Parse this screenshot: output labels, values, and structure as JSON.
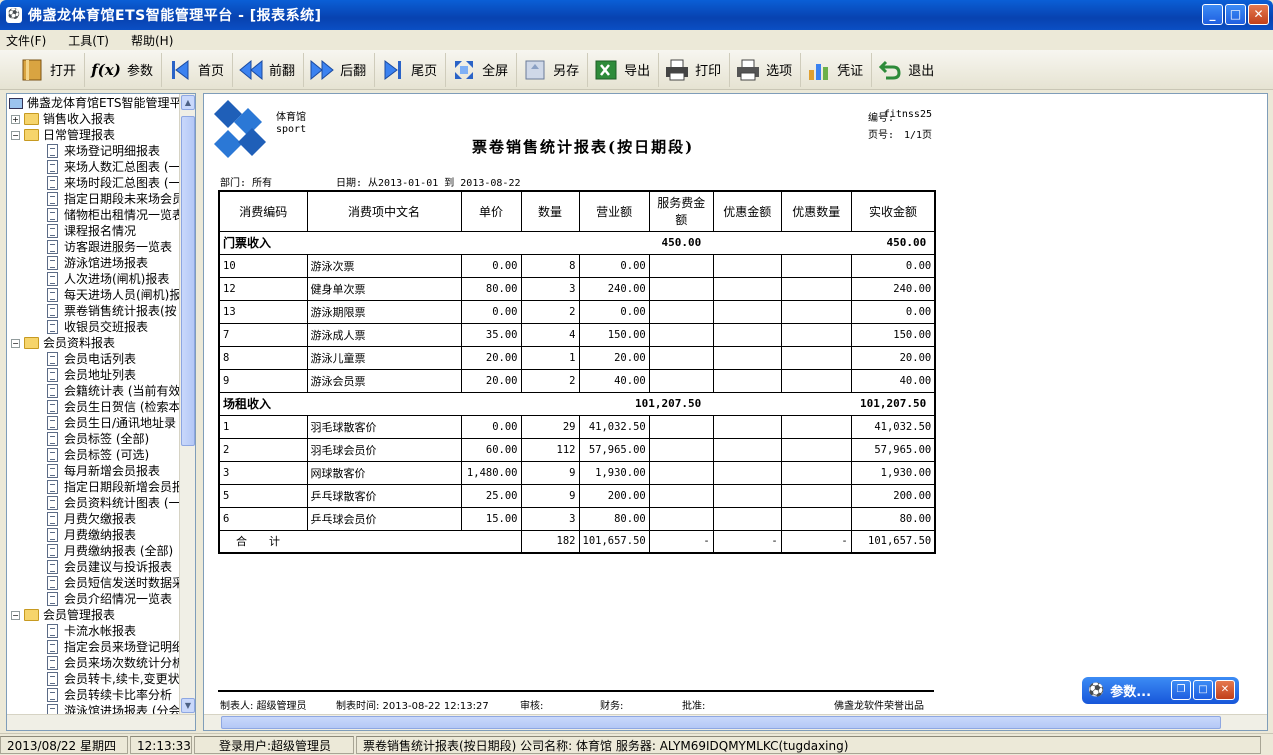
{
  "window": {
    "title": "佛盏龙体育馆ETS智能管理平台 - [报表系统]"
  },
  "menu": [
    "文件(F)",
    "工具(T)",
    "帮助(H)"
  ],
  "toolbar": {
    "open": "打开",
    "params": "参数",
    "first": "首页",
    "prev": "前翻",
    "next": "后翻",
    "last": "尾页",
    "fullscreen": "全屏",
    "saveas": "另存",
    "export": "导出",
    "print": "打印",
    "options": "选项",
    "voucher": "凭证",
    "exit": "退出",
    "fx_glyph": "f(x)"
  },
  "tree": {
    "root": "佛盏龙体育馆ETS智能管理平台",
    "items": [
      {
        "label": "销售收入报表",
        "level": 1,
        "folder": true,
        "expanded": false
      },
      {
        "label": "日常管理报表",
        "level": 1,
        "folder": true,
        "expanded": true
      },
      {
        "label": "来场登记明细报表",
        "level": 2
      },
      {
        "label": "来场人数汇总图表 (一",
        "level": 2
      },
      {
        "label": "来场时段汇总图表 (一",
        "level": 2
      },
      {
        "label": "指定日期段未来场会员",
        "level": 2
      },
      {
        "label": "储物柜出租情况一览表",
        "level": 2
      },
      {
        "label": "课程报名情况",
        "level": 2
      },
      {
        "label": "访客跟进服务一览表",
        "level": 2
      },
      {
        "label": "游泳馆进场报表",
        "level": 2
      },
      {
        "label": "人次进场(闸机)报表",
        "level": 2
      },
      {
        "label": "每天进场人员(闸机)报",
        "level": 2
      },
      {
        "label": "票卷销售统计报表(按",
        "level": 2,
        "selected": true
      },
      {
        "label": "收银员交班报表",
        "level": 2
      },
      {
        "label": "会员资料报表",
        "level": 1,
        "folder": true,
        "expanded": true
      },
      {
        "label": "会员电话列表",
        "level": 2
      },
      {
        "label": "会员地址列表",
        "level": 2
      },
      {
        "label": "会籍统计表 (当前有效",
        "level": 2
      },
      {
        "label": "会员生日贺信 (检索本",
        "level": 2
      },
      {
        "label": "会员生日/通讯地址录",
        "level": 2
      },
      {
        "label": "会员标签 (全部)",
        "level": 2
      },
      {
        "label": "会员标签 (可选)",
        "level": 2
      },
      {
        "label": "每月新增会员报表",
        "level": 2
      },
      {
        "label": "指定日期段新增会员报",
        "level": 2
      },
      {
        "label": "会员资料统计图表 (一",
        "level": 2
      },
      {
        "label": "月费欠缴报表",
        "level": 2
      },
      {
        "label": "月费缴纳报表",
        "level": 2
      },
      {
        "label": "月费缴纳报表 (全部)",
        "level": 2
      },
      {
        "label": "会员建议与投诉报表",
        "level": 2
      },
      {
        "label": "会员短信发送时数据采",
        "level": 2
      },
      {
        "label": "会员介绍情况一览表",
        "level": 2
      },
      {
        "label": "会员管理报表",
        "level": 1,
        "folder": true,
        "expanded": true
      },
      {
        "label": "卡流水帐报表",
        "level": 2
      },
      {
        "label": "指定会员来场登记明细",
        "level": 2
      },
      {
        "label": "会员来场次数统计分析",
        "level": 2
      },
      {
        "label": "会员转卡,续卡,变更状",
        "level": 2
      },
      {
        "label": "会员转续卡比率分析",
        "level": 2
      },
      {
        "label": "游泳馆进场报表 (分会",
        "level": 2
      }
    ]
  },
  "report": {
    "logo_text1": "体育馆",
    "logo_text2": "sport",
    "code_label": "编号:",
    "code_value": "fitnss25",
    "page_label": "页号:",
    "page_value": "1/1页",
    "title": "票卷销售统计报表(按日期段)",
    "dept": "部门: 所有",
    "date_range": "日期: 从2013-01-01 到 2013-08-22",
    "headers": [
      "消费编码",
      "消费项中文名",
      "单价",
      "数量",
      "营业额",
      "服务费金额",
      "优惠金额",
      "优惠数量",
      "实收金额"
    ],
    "groups": [
      {
        "name": "门票收入",
        "revenue": "450.00",
        "actual": "450.00",
        "rows": [
          {
            "code": "10",
            "name": "游泳次票",
            "price": "0.00",
            "qty": "8",
            "revenue": "0.00",
            "actual": "0.00"
          },
          {
            "code": "12",
            "name": "健身单次票",
            "price": "80.00",
            "qty": "3",
            "revenue": "240.00",
            "actual": "240.00"
          },
          {
            "code": "13",
            "name": "游泳期限票",
            "price": "0.00",
            "qty": "2",
            "revenue": "0.00",
            "actual": "0.00"
          },
          {
            "code": "7",
            "name": "游泳成人票",
            "price": "35.00",
            "qty": "4",
            "revenue": "150.00",
            "actual": "150.00"
          },
          {
            "code": "8",
            "name": "游泳儿童票",
            "price": "20.00",
            "qty": "1",
            "revenue": "20.00",
            "actual": "20.00"
          },
          {
            "code": "9",
            "name": "游泳会员票",
            "price": "20.00",
            "qty": "2",
            "revenue": "40.00",
            "actual": "40.00"
          }
        ]
      },
      {
        "name": "场租收入",
        "revenue": "101,207.50",
        "actual": "101,207.50",
        "rows": [
          {
            "code": "1",
            "name": "羽毛球散客价",
            "price": "0.00",
            "qty": "29",
            "revenue": "41,032.50",
            "actual": "41,032.50"
          },
          {
            "code": "2",
            "name": "羽毛球会员价",
            "price": "60.00",
            "qty": "112",
            "revenue": "57,965.00",
            "actual": "57,965.00"
          },
          {
            "code": "3",
            "name": "网球散客价",
            "price": "1,480.00",
            "qty": "9",
            "revenue": "1,930.00",
            "actual": "1,930.00"
          },
          {
            "code": "5",
            "name": "乒乓球散客价",
            "price": "25.00",
            "qty": "9",
            "revenue": "200.00",
            "actual": "200.00"
          },
          {
            "code": "6",
            "name": "乒乓球会员价",
            "price": "15.00",
            "qty": "3",
            "revenue": "80.00",
            "actual": "80.00"
          }
        ]
      }
    ],
    "total": {
      "label": "合　　计",
      "qty": "182",
      "revenue": "101,657.50",
      "service": "-",
      "discount": "-",
      "discount_qty": "-",
      "actual": "101,657.50"
    },
    "footer": {
      "maker": "制表人: 超级管理员",
      "time": "制表时间: 2013-08-22 12:13:27",
      "audit": "审核:",
      "finance": "财务:",
      "approve": "批准:",
      "vendor": "佛盏龙软件荣誉出品"
    }
  },
  "param_panel": {
    "label": "参数..."
  },
  "status": {
    "date": "2013/08/22 星期四",
    "time": "12:13:33",
    "user": "登录用户:超级管理员",
    "info": "票卷销售统计报表(按日期段) 公司名称: 体育馆 服务器: ALYM69IDQMYMLKC(tugdaxing)"
  }
}
